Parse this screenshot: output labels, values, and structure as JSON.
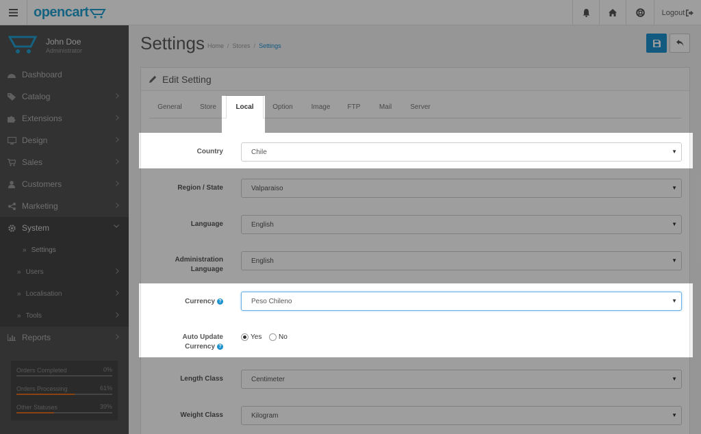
{
  "header": {
    "logo_text": "opencart",
    "logout_label": "Logout",
    "icons": [
      "bars-icon",
      "bell-icon",
      "home-icon",
      "life-ring-icon",
      "sign-out-icon"
    ]
  },
  "sidebar": {
    "user_name": "John Doe",
    "user_role": "Administrator",
    "items": [
      {
        "label": "Dashboard",
        "icon": "dashboard-icon"
      },
      {
        "label": "Catalog",
        "icon": "tag-icon"
      },
      {
        "label": "Extensions",
        "icon": "puzzle-icon"
      },
      {
        "label": "Design",
        "icon": "monitor-icon"
      },
      {
        "label": "Sales",
        "icon": "cart-icon"
      },
      {
        "label": "Customers",
        "icon": "user-icon"
      },
      {
        "label": "Marketing",
        "icon": "share-icon"
      },
      {
        "label": "System",
        "icon": "cog-icon"
      }
    ],
    "system_sub": [
      {
        "label": "Settings"
      },
      {
        "label": "Users"
      },
      {
        "label": "Localisation"
      },
      {
        "label": "Tools"
      }
    ],
    "reports_label": "Reports",
    "stats": [
      {
        "label": "Orders Completed",
        "value": "0%",
        "fraction": 0
      },
      {
        "label": "Orders Processing",
        "value": "61%",
        "fraction": 0.61
      },
      {
        "label": "Other Statuses",
        "value": "39%",
        "fraction": 0.39
      }
    ]
  },
  "page": {
    "title": "Settings",
    "breadcrumb": [
      "Home",
      "Stores",
      "Settings"
    ],
    "panel_title": "Edit Setting"
  },
  "tabs": [
    "General",
    "Store",
    "Local",
    "Option",
    "Image",
    "FTP",
    "Mail",
    "Server"
  ],
  "active_tab": "Local",
  "form": {
    "country": {
      "label": "Country",
      "value": "Chile"
    },
    "region": {
      "label": "Region / State",
      "value": "Valparaiso"
    },
    "language": {
      "label": "Language",
      "value": "English"
    },
    "admin_language": {
      "label_line1": "Administration",
      "label_line2": "Language",
      "value": "English"
    },
    "currency": {
      "label": "Currency",
      "value": "Peso Chileno"
    },
    "auto_update": {
      "label_line1": "Auto Update",
      "label_line2": "Currency",
      "yes": "Yes",
      "no": "No",
      "selected": "Yes"
    },
    "length_class": {
      "label": "Length Class",
      "value": "Centimeter"
    },
    "weight_class": {
      "label": "Weight Class",
      "value": "Kilogram"
    }
  },
  "colors": {
    "accent": "#1e91cf",
    "sidebar": "#515151",
    "logo": "#23a1d1",
    "progress": "#e06c1d"
  }
}
